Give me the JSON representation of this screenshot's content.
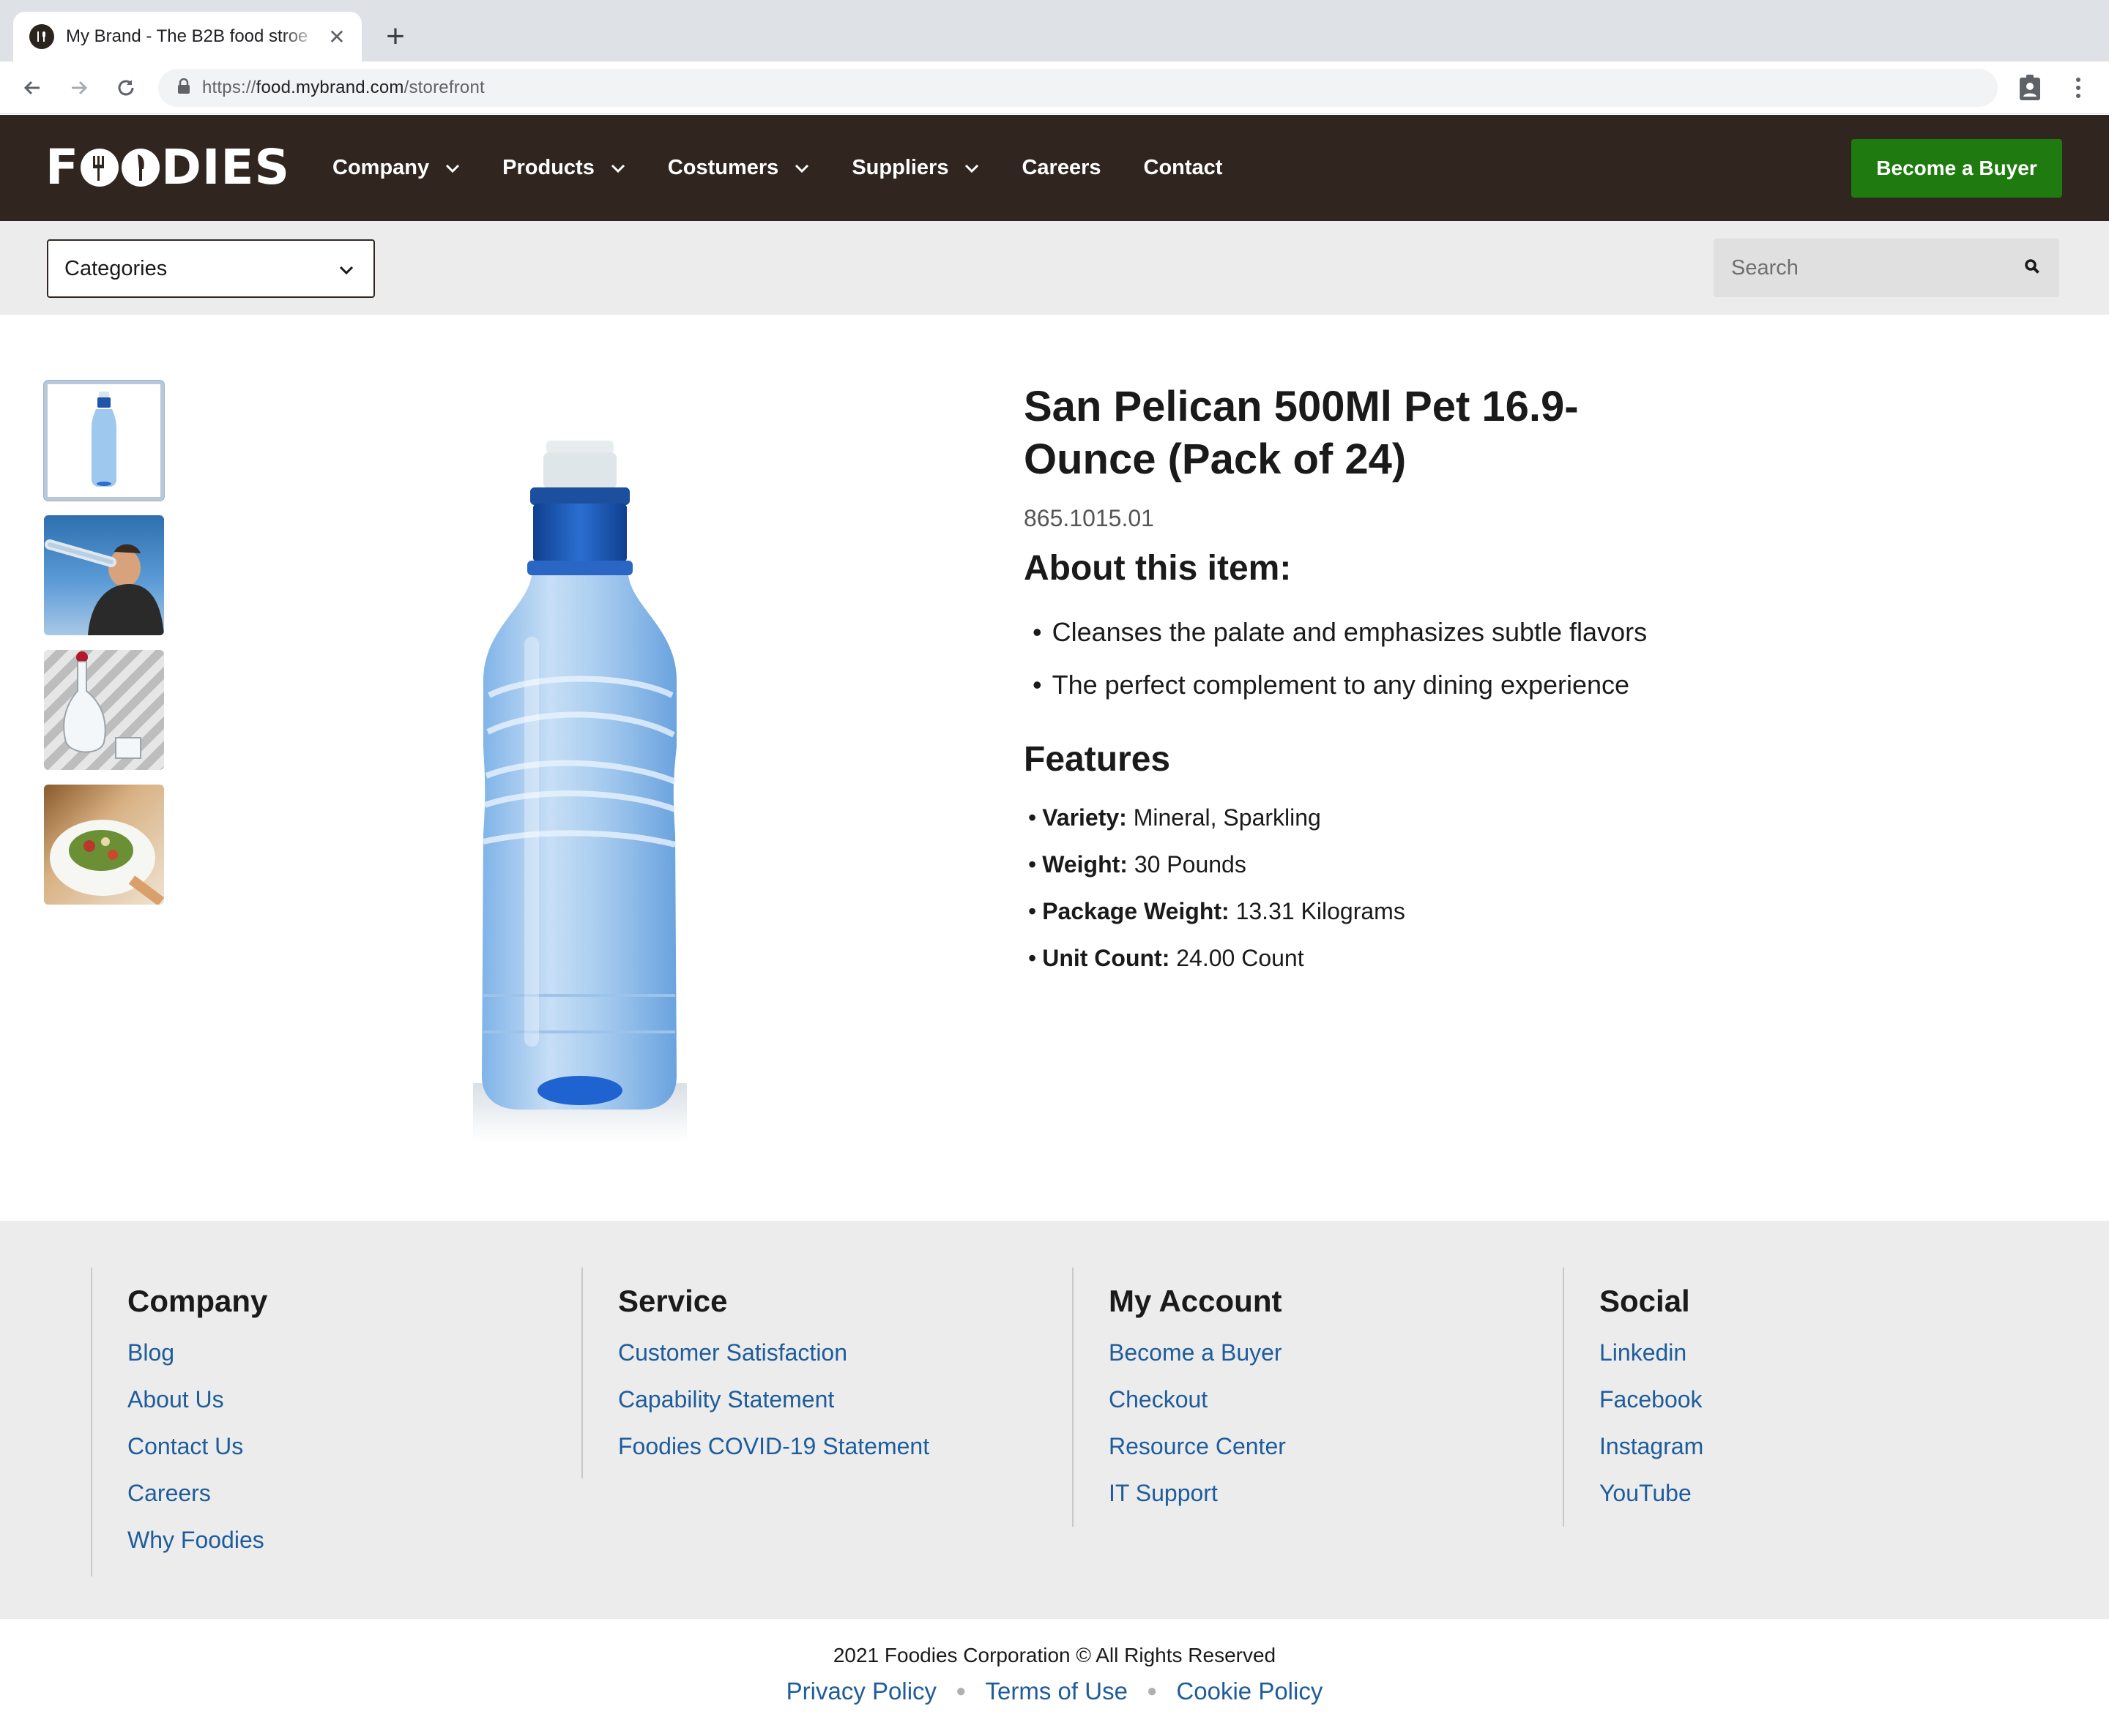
{
  "browser": {
    "tab_title": "My Brand - The B2B food stroe",
    "tab_close": "✕",
    "new_tab": "+",
    "url_scheme": "https://",
    "url_host": "food.mybrand.com",
    "url_path": "/storefront"
  },
  "header": {
    "logo_text_first": "F",
    "logo_text_last": "DIES",
    "nav": [
      {
        "label": "Company",
        "dropdown": true
      },
      {
        "label": "Products",
        "dropdown": true
      },
      {
        "label": "Costumers",
        "dropdown": true
      },
      {
        "label": "Suppliers",
        "dropdown": true
      },
      {
        "label": "Careers",
        "dropdown": false
      },
      {
        "label": "Contact",
        "dropdown": false
      }
    ],
    "cta_label": "Become a Buyer",
    "cta_color": "#1f7a0f",
    "bg_color": "#30261f"
  },
  "subbar": {
    "categories_label": "Categories",
    "search_placeholder": "Search"
  },
  "product": {
    "title": "San Pelican 500Ml Pet 16.9-Ounce (Pack of 24)",
    "sku": "865.1015.01",
    "about_heading": "About this item:",
    "about_items": [
      "Cleanses the palate and emphasizes subtle flavors",
      "The perfect complement to any dining experience"
    ],
    "features_heading": "Features",
    "features": [
      {
        "label": "Variety:",
        "value": "Mineral, Sparkling"
      },
      {
        "label": "Weight:",
        "value": "30 Pounds"
      },
      {
        "label": "Package Weight:",
        "value": "13.31 Kilograms"
      },
      {
        "label": "Unit Count:",
        "value": "24.00 Count"
      }
    ]
  },
  "footer": {
    "columns": [
      {
        "heading": "Company",
        "links": [
          "Blog",
          "About Us",
          "Contact Us",
          "Careers",
          "Why Foodies"
        ]
      },
      {
        "heading": "Service",
        "links": [
          "Customer Satisfaction",
          "Capability Statement",
          "Foodies COVID-19 Statement"
        ]
      },
      {
        "heading": "My Account",
        "links": [
          "Become a Buyer",
          "Checkout",
          "Resource Center",
          "IT Support"
        ]
      },
      {
        "heading": "Social",
        "links": [
          "Linkedin",
          "Facebook",
          "Instagram",
          "YouTube"
        ]
      }
    ],
    "copyright": "2021 Foodies Corporation © All Rights Reserved",
    "legal_links": [
      "Privacy Policy",
      "Terms of Use",
      "Cookie Policy"
    ],
    "link_color": "#1e5c9b"
  }
}
